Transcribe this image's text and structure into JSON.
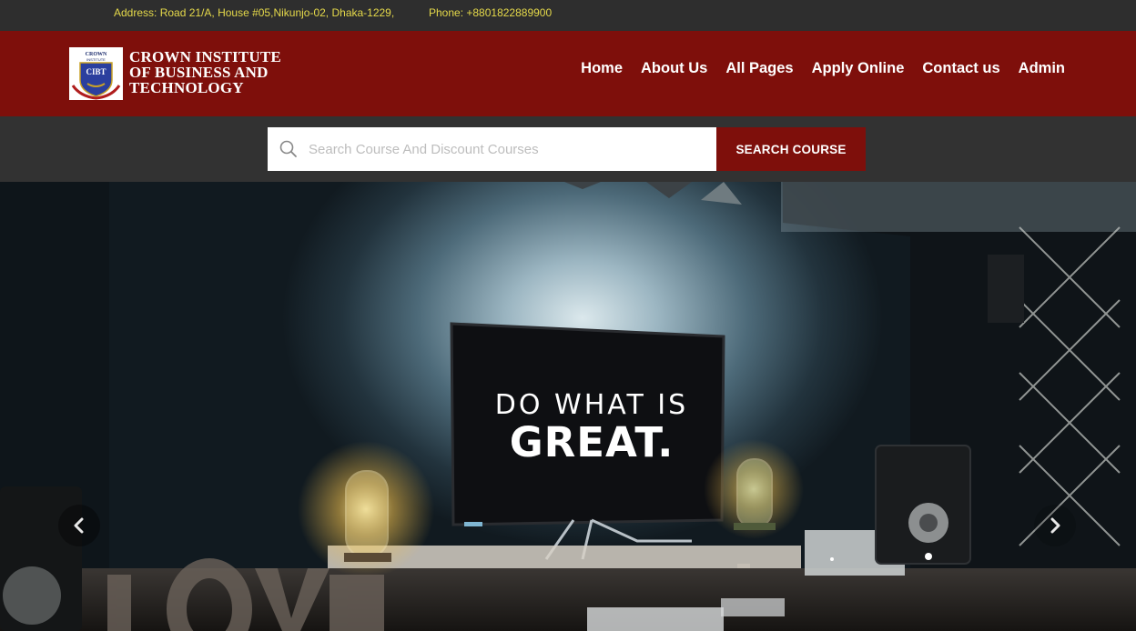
{
  "topbar": {
    "address": "Address: Road 21/A, House #05,Nikunjo-02, Dhaka-1229,",
    "phone": "Phone: +8801822889900"
  },
  "brand": {
    "logo_text_top": "CROWN",
    "logo_text_sub": "INSTITUTE",
    "logo_initials": "CIBT",
    "name_line1": "CROWN INSTITUTE",
    "name_line2": "OF BUSINESS AND",
    "name_line3": "TECHNOLOGY"
  },
  "nav": {
    "items": [
      {
        "label": "Home"
      },
      {
        "label": "About Us"
      },
      {
        "label": "All Pages"
      },
      {
        "label": "Apply Online"
      },
      {
        "label": "Contact us"
      },
      {
        "label": "Admin"
      }
    ]
  },
  "search": {
    "placeholder": "Search Course And Discount Courses",
    "value": "",
    "button_label": "SEARCH COURSE"
  },
  "hero": {
    "slide_line1": "DO WHAT IS",
    "slide_line2": "GREAT.",
    "prev_icon": "chevron-left-icon",
    "next_icon": "chevron-right-icon"
  },
  "colors": {
    "brand_red": "#7e0f0b",
    "topbar_bg": "#2e2e2e",
    "topbar_text": "#e5d94a",
    "searchbar_bg": "#323232"
  }
}
